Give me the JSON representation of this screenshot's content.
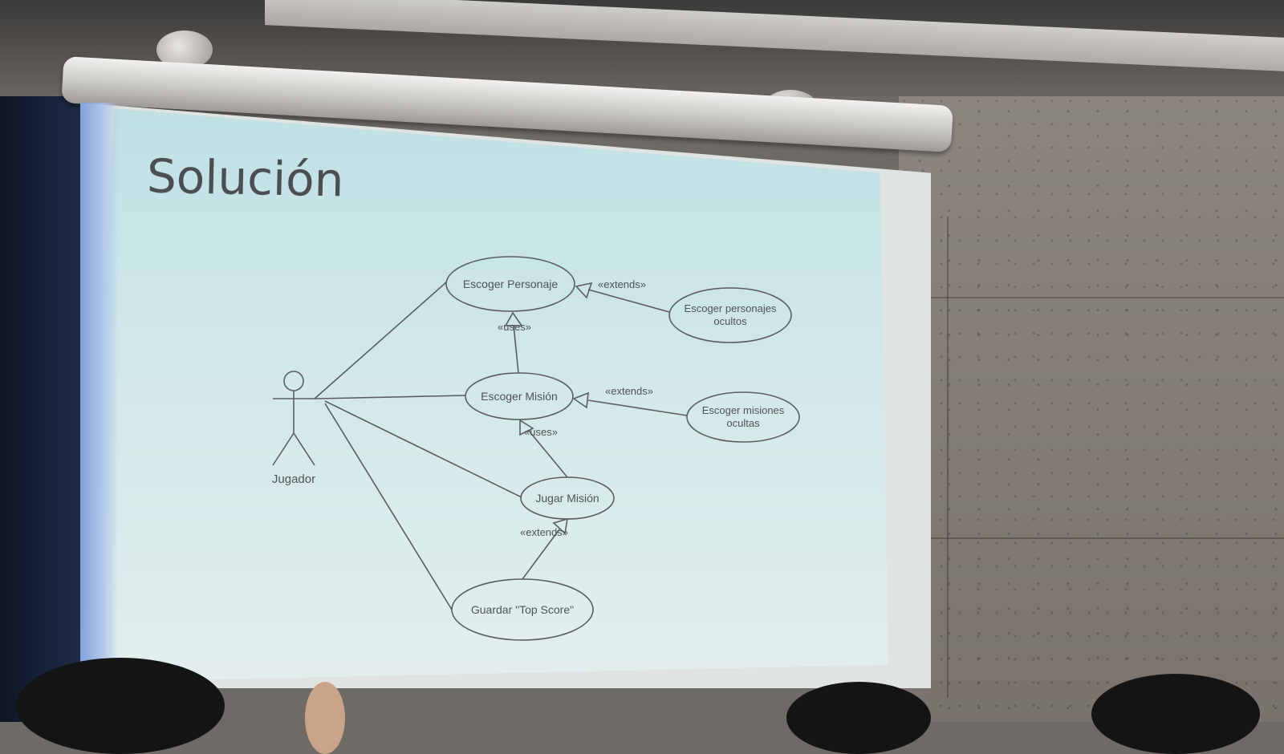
{
  "slide": {
    "title": "Solución"
  },
  "diagram": {
    "actor": {
      "label": "Jugador"
    },
    "use_cases": [
      {
        "id": "escoger-personaje",
        "label": "Escoger Personaje"
      },
      {
        "id": "escoger-personajes-ocultos",
        "label": "Escoger personajes ocultos",
        "lines": [
          "Escoger personajes",
          "ocultos"
        ]
      },
      {
        "id": "escoger-mision",
        "label": "Escoger Misión"
      },
      {
        "id": "escoger-misiones-ocultas",
        "label": "Escoger misiones ocultas",
        "lines": [
          "Escoger misiones",
          "ocultas"
        ]
      },
      {
        "id": "jugar-mision",
        "label": "Jugar Misión"
      },
      {
        "id": "guardar-top-score",
        "label": "Guardar \"Top Score\""
      }
    ],
    "relations": [
      {
        "from": "escoger-personajes-ocultos",
        "to": "escoger-personaje",
        "stereotype": "«extends»"
      },
      {
        "from": "escoger-mision",
        "to": "escoger-personaje",
        "stereotype": "«uses»"
      },
      {
        "from": "escoger-misiones-ocultas",
        "to": "escoger-mision",
        "stereotype": "«extends»"
      },
      {
        "from": "jugar-mision",
        "to": "escoger-mision",
        "stereotype": "«uses»"
      },
      {
        "from": "guardar-top-score",
        "to": "jugar-mision",
        "stereotype": "«extends»"
      }
    ],
    "colors": {
      "line": "#5a5e61",
      "slide_background": "#cfe7e9",
      "title": "#4b4e52"
    }
  }
}
